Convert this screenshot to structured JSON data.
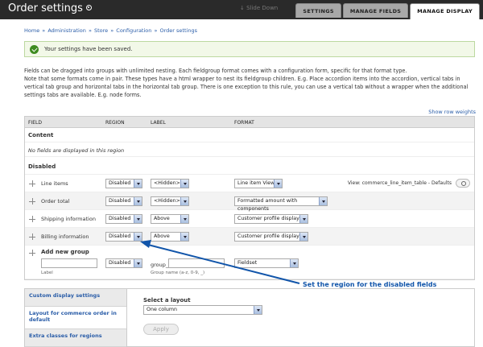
{
  "header": {
    "title": "Order settings",
    "slide_down": "↓ Slide Down",
    "tabs": [
      "SETTINGS",
      "MANAGE FIELDS",
      "MANAGE DISPLAY"
    ]
  },
  "breadcrumb": [
    "Home",
    "Administration",
    "Store",
    "Configuration",
    "Order settings"
  ],
  "status": {
    "message": "Your settings have been saved."
  },
  "description": [
    "Fields can be dragged into groups with unlimited nesting. Each fieldgroup format comes with a configuration form, specific for that format type.",
    "Note that some formats come in pair. These types have a html wrapper to nest its fieldgroup children. E.g. Place accordion items into the accordion, vertical tabs in vertical tab group and horizontal tabs in the horizontal tab group. There is one exception to this rule, you can use a vertical tab without a wrapper when the additional settings tabs are available. E.g. node forms."
  ],
  "show_weights": "Show row weights",
  "table": {
    "columns": [
      "FIELD",
      "REGION",
      "LABEL",
      "FORMAT"
    ],
    "content_region": {
      "title": "Content",
      "empty": "No fields are displayed in this region"
    },
    "disabled_region": {
      "title": "Disabled"
    },
    "rows": [
      {
        "field": "Line items",
        "region": "Disabled",
        "label": "<Hidden>",
        "format": "Line item View",
        "extra": "View: commerce_line_item_table - Defaults"
      },
      {
        "field": "Order total",
        "region": "Disabled",
        "label": "<Hidden>",
        "format": "Formatted amount with components"
      },
      {
        "field": "Shipping information",
        "region": "Disabled",
        "label": "Above",
        "format": "Customer profile display"
      },
      {
        "field": "Billing information",
        "region": "Disabled",
        "label": "Above",
        "format": "Customer profile display"
      }
    ],
    "add_group": {
      "title": "Add new group",
      "label_hint": "Label",
      "region": "Disabled",
      "group_prefix": "group_",
      "name_hint": "Group name (a-z, 0-9, _)",
      "format": "Fieldset"
    }
  },
  "annotation": "Set the region for the disabled fields",
  "annotation_color": "#1155aa",
  "vertical_tabs": [
    "Custom display settings",
    "Layout for commerce order in default",
    "Extra classes for regions"
  ],
  "layout": {
    "title": "Select a layout",
    "selected": "One column",
    "apply": "Apply"
  }
}
